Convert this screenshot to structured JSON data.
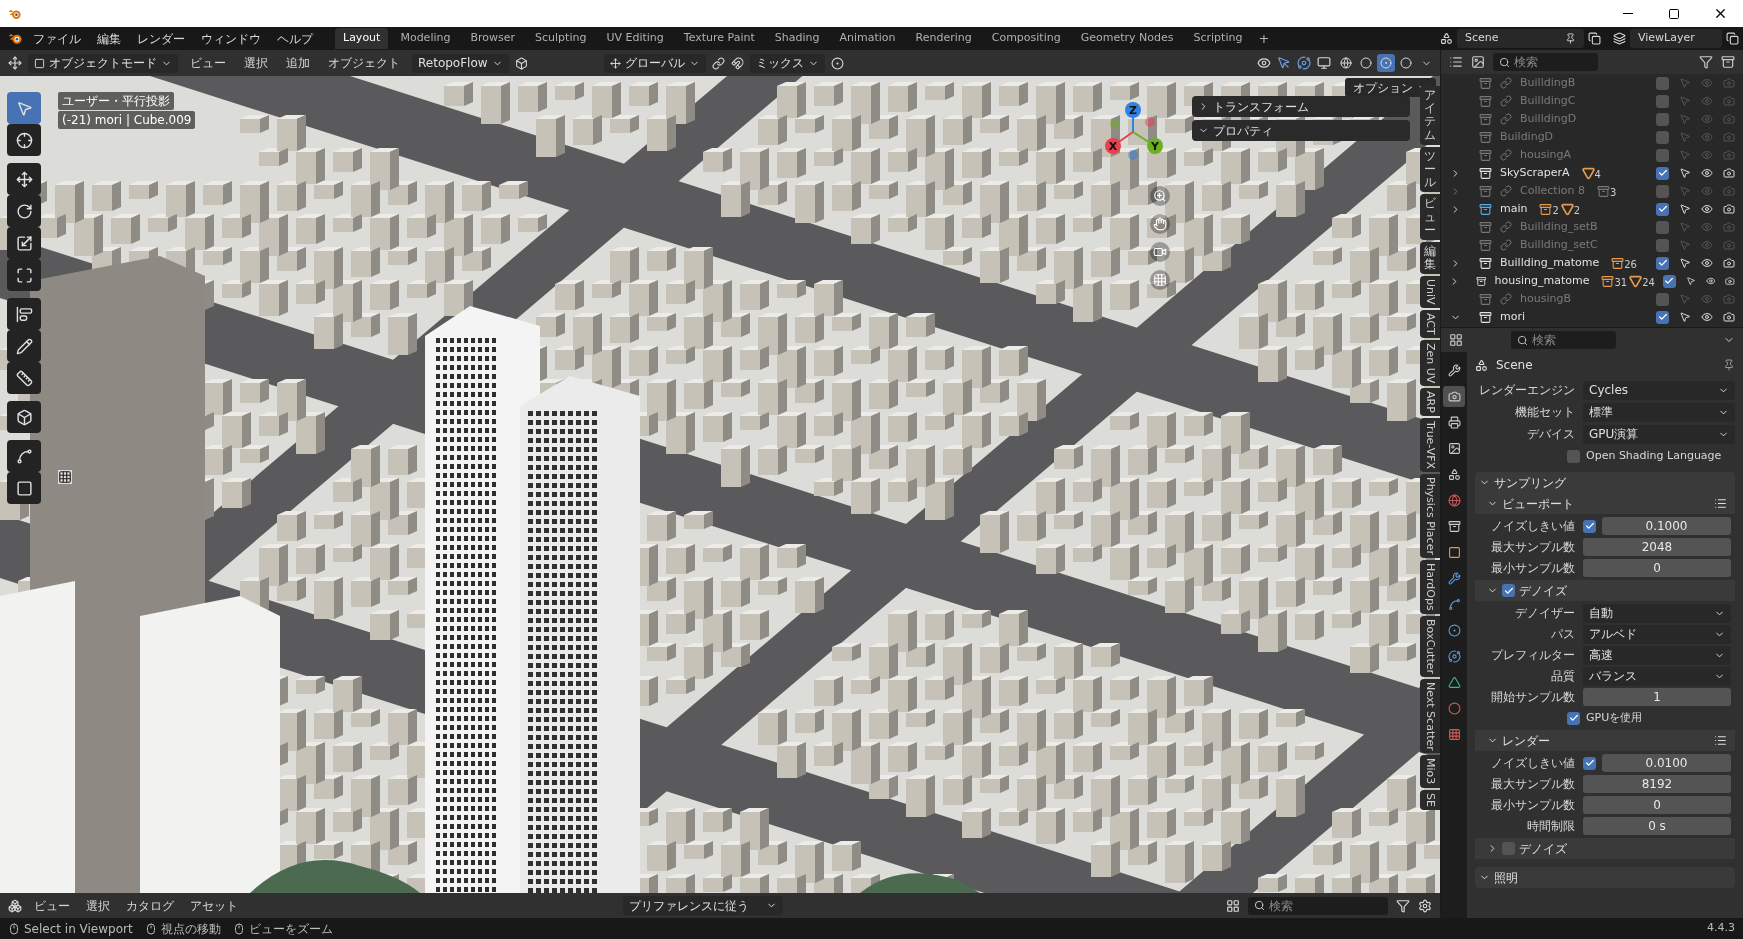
{
  "menu_bar": {
    "menus": [
      "ファイル",
      "編集",
      "レンダー",
      "ウィンドウ",
      "ヘルプ"
    ],
    "workspaces": [
      {
        "label": "Layout",
        "selected": true
      },
      {
        "label": "Modeling",
        "selected": false
      },
      {
        "label": "Browser",
        "selected": false
      },
      {
        "label": "Sculpting",
        "selected": false
      },
      {
        "label": "UV Editing",
        "selected": false
      },
      {
        "label": "Texture Paint",
        "selected": false
      },
      {
        "label": "Shading",
        "selected": false
      },
      {
        "label": "Animation",
        "selected": false
      },
      {
        "label": "Rendering",
        "selected": false
      },
      {
        "label": "Compositing",
        "selected": false
      },
      {
        "label": "Geometry Nodes",
        "selected": false
      },
      {
        "label": "Scripting",
        "selected": false
      }
    ],
    "add_tab": "+",
    "scene": "Scene",
    "view_layer": "ViewLayer"
  },
  "viewport_header": {
    "mode": "オブジェクトモード",
    "menus": [
      "ビュー",
      "選択",
      "追加",
      "オブジェクト"
    ],
    "addon": "RetopoFlow",
    "orientation": "グローバル",
    "snap": "ミックス",
    "shading": [
      {
        "selected": false
      },
      {
        "selected": false
      },
      {
        "selected": true
      },
      {
        "selected": false
      }
    ]
  },
  "viewport": {
    "view_name": "ユーザー・平行投影",
    "object_info": "(-21) mori | Cube.009",
    "options_button": "オプション",
    "tools": [
      {
        "selected": true
      },
      {
        "selected": false
      },
      {
        "selected": false
      },
      {
        "selected": false
      },
      {
        "selected": false
      },
      {
        "selected": false
      },
      {
        "selected": false
      },
      {
        "selected": false
      },
      {
        "selected": false
      },
      {
        "selected": false
      },
      {
        "selected": false
      },
      {
        "selected": false
      }
    ],
    "gizmo_axes": [
      {
        "label": "X",
        "color": "#e8404f"
      },
      {
        "label": "Y",
        "color": "#6ab021"
      },
      {
        "label": "Z",
        "color": "#2f83e0"
      }
    ],
    "sidebar_panels": [
      {
        "title": "トランスフォーム",
        "expanded": false
      },
      {
        "title": "プロパティ",
        "expanded": true
      }
    ],
    "sidebar_tabs": [
      {
        "label": "アイテム",
        "kind": "cjk"
      },
      {
        "label": "ツール",
        "kind": "cjk"
      },
      {
        "label": "ビュー",
        "kind": "cjk"
      },
      {
        "label": "編集",
        "kind": "cjk"
      },
      {
        "label": "UniV",
        "kind": "latin"
      },
      {
        "label": "ACT",
        "kind": "latin"
      },
      {
        "label": "Zen UV",
        "kind": "latin"
      },
      {
        "label": "ARP",
        "kind": "latin"
      },
      {
        "label": "True-VFX",
        "kind": "latin"
      },
      {
        "label": "Physics Placer",
        "kind": "latin"
      },
      {
        "label": "HardOps",
        "kind": "latin"
      },
      {
        "label": "BoxCutter",
        "kind": "latin"
      },
      {
        "label": "Next Scatter",
        "kind": "latin"
      },
      {
        "label": "Mio3",
        "kind": "latin"
      },
      {
        "label": "SE",
        "kind": "latin"
      }
    ]
  },
  "asset_header": {
    "menus": [
      "ビュー",
      "選択",
      "カタログ",
      "アセット"
    ],
    "import_method": "プリファレンスに従う",
    "search_placeholder": "検索"
  },
  "outliner": {
    "search_placeholder": "検索",
    "rows": [
      {
        "name": "BuilldingB",
        "instanced": true,
        "included": false,
        "active": false
      },
      {
        "name": "BuilldingC",
        "instanced": true,
        "included": false,
        "active": false
      },
      {
        "name": "BuilldingD",
        "instanced": true,
        "included": false,
        "active": false
      },
      {
        "name": "BuildingD",
        "instanced": false,
        "included": false,
        "active": false
      },
      {
        "name": "housingA",
        "instanced": true,
        "included": false,
        "active": false
      },
      {
        "name": "SkyScraperA",
        "expanded": false,
        "instanced": false,
        "included": true,
        "active": false,
        "badges": [
          {
            "kind": "mesh",
            "count": "4"
          }
        ]
      },
      {
        "name": "Collection 8",
        "expanded": false,
        "instanced": true,
        "included": false,
        "active": false,
        "badges": [
          {
            "kind": "collection",
            "count": "3"
          }
        ]
      },
      {
        "name": "main",
        "expanded": false,
        "instanced": false,
        "included": true,
        "active": true,
        "badges": [
          {
            "kind": "collection",
            "count": "2"
          },
          {
            "kind": "mesh",
            "count": "2"
          }
        ]
      },
      {
        "name": "Buillding_setB",
        "instanced": true,
        "included": false,
        "active": false
      },
      {
        "name": "Buillding_setC",
        "instanced": true,
        "included": false,
        "active": false
      },
      {
        "name": "Buillding_matome",
        "expanded": false,
        "instanced": false,
        "included": true,
        "active": false,
        "badges": [
          {
            "kind": "collection",
            "count": "26"
          }
        ]
      },
      {
        "name": "housing_matome",
        "expanded": false,
        "instanced": false,
        "included": true,
        "active": false,
        "badges": [
          {
            "kind": "collection",
            "count": "31"
          },
          {
            "kind": "mesh",
            "count": "24"
          }
        ]
      },
      {
        "name": "housingB",
        "instanced": true,
        "included": false,
        "active": false
      },
      {
        "name": "mori",
        "expanded": true,
        "instanced": false,
        "included": true,
        "active": false
      }
    ]
  },
  "properties": {
    "search_placeholder": "検索",
    "context": "Scene",
    "tabs": [
      {
        "selected": false
      },
      {
        "selected": true
      },
      {
        "selected": false
      },
      {
        "selected": false
      },
      {
        "selected": false
      },
      {
        "selected": false
      },
      {
        "selected": false
      },
      {
        "selected": false
      },
      {
        "selected": false
      },
      {
        "selected": false
      },
      {
        "selected": false
      },
      {
        "selected": false
      },
      {
        "selected": false
      },
      {
        "selected": false
      },
      {
        "selected": false
      }
    ],
    "rows": [
      {
        "kind": "dropdown",
        "label": "レンダーエンジン",
        "value": "Cycles"
      },
      {
        "kind": "dropdown",
        "label": "機能セット",
        "value": "標準"
      },
      {
        "kind": "dropdown",
        "label": "デバイス",
        "value": "GPU演算"
      },
      {
        "kind": "check",
        "label": "Open Shading Language",
        "checked": false
      }
    ],
    "panels": [
      {
        "title": "サンプリング",
        "expanded": true,
        "subpanels": [
          {
            "title": "ビューポート",
            "expanded": true,
            "presets": true,
            "rows": [
              {
                "kind": "toggle_number",
                "label": "ノイズしきい値",
                "checked": true,
                "value": "0.1000"
              },
              {
                "kind": "number",
                "label": "最大サンプル数",
                "value": "2048"
              },
              {
                "kind": "number",
                "label": "最小サンプル数",
                "value": "0"
              }
            ]
          },
          {
            "title": "デノイズ",
            "expanded": true,
            "checked": true,
            "rows": [
              {
                "kind": "dropdown",
                "label": "デノイザー",
                "value": "自動"
              },
              {
                "kind": "dropdown",
                "label": "パス",
                "value": "アルベド"
              },
              {
                "kind": "dropdown",
                "label": "プレフィルター",
                "value": "高速"
              },
              {
                "kind": "dropdown",
                "label": "品質",
                "value": "バランス"
              },
              {
                "kind": "number",
                "label": "開始サンプル数",
                "value": "1"
              },
              {
                "kind": "check",
                "label": "GPUを使用",
                "checked": true
              }
            ]
          },
          {
            "title": "レンダー",
            "expanded": true,
            "presets": true,
            "rows": [
              {
                "kind": "toggle_number",
                "label": "ノイズしきい値",
                "checked": true,
                "value": "0.0100"
              },
              {
                "kind": "number",
                "label": "最大サンプル数",
                "value": "8192"
              },
              {
                "kind": "number",
                "label": "最小サンプル数",
                "value": "0"
              },
              {
                "kind": "number",
                "label": "時間制限",
                "value": "0 s"
              }
            ]
          },
          {
            "title": "デノイズ",
            "expanded": false,
            "checked": false
          }
        ]
      },
      {
        "title": "照明",
        "expanded": true
      }
    ]
  },
  "status_bar": {
    "hints": [
      "Select in Viewport",
      "視点の移動",
      "ビューをズーム"
    ],
    "version": "4.4.3"
  }
}
